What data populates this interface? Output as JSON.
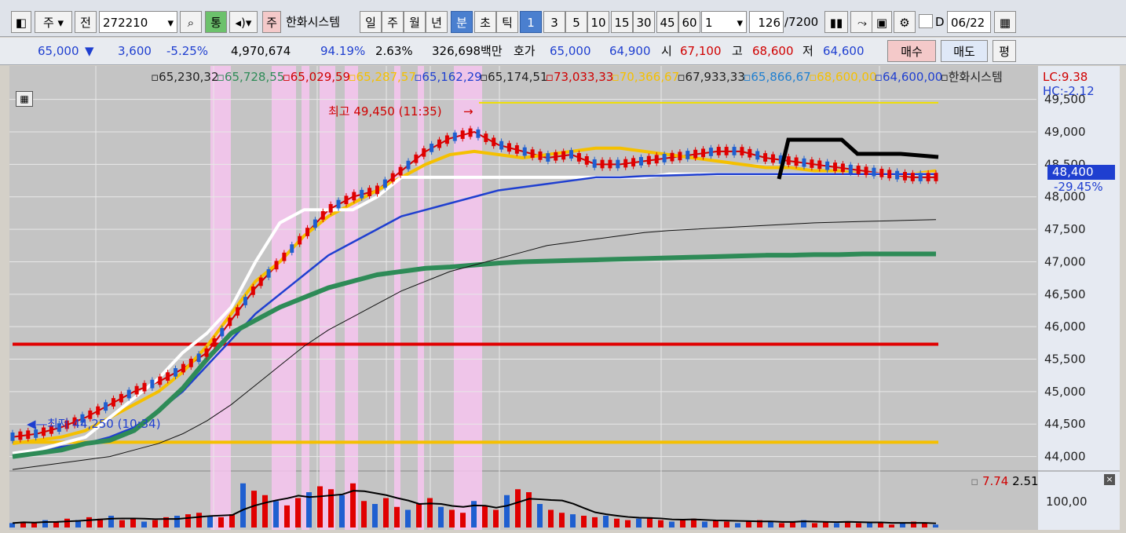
{
  "toolbar": {
    "period_dropdown": "주",
    "prev_button": "전",
    "stock_code": "272210",
    "tong_button": "통",
    "ju_badge": "주",
    "stock_name": "한화시스템",
    "period_buttons": [
      "일",
      "주",
      "월",
      "년",
      "분",
      "초",
      "틱"
    ],
    "selected_period": "분",
    "interval_buttons": [
      "1",
      "3",
      "5",
      "10",
      "15",
      "30",
      "45",
      "60"
    ],
    "selected_interval": "1",
    "multiplier_value": "1",
    "count_value": "126",
    "count_total": "/7200",
    "d_label": "D",
    "date_value": "06/22"
  },
  "quote": {
    "price": "65,000",
    "down_arrow": "▼",
    "change": "3,600",
    "change_pct": "-5.25%",
    "volume": "4,970,674",
    "vol_ratio": "94.19%",
    "turnover": "2.63%",
    "amount": "326,698백만",
    "hoga_label": "호가",
    "ask": "65,000",
    "bid": "64,900",
    "open_label": "시",
    "open": "67,100",
    "high_label": "고",
    "high": "68,600",
    "low_label": "저",
    "low": "64,600",
    "buy_button": "매수",
    "sell_button": "매도",
    "pyeong_button": "평"
  },
  "legend": {
    "items": [
      {
        "text": "65,230,32",
        "color": "#222222"
      },
      {
        "text": "65,728,55",
        "color": "#2e8b57"
      },
      {
        "text": "65,029,59",
        "color": "#d00000"
      },
      {
        "text": "65,287,57",
        "color": "#f5c000"
      },
      {
        "text": "65,162,29",
        "color": "#1f3fd0"
      },
      {
        "text": "65,174,51",
        "color": "#222222"
      },
      {
        "text": "73,033,33",
        "color": "#d00000"
      },
      {
        "text": "70,366,67",
        "color": "#f5c000"
      },
      {
        "text": "67,933,33",
        "color": "#222222"
      },
      {
        "text": "65,866,67",
        "color": "#1f7fd0"
      },
      {
        "text": "68,600,00",
        "color": "#f5c000"
      },
      {
        "text": "64,600,00",
        "color": "#1f3fd0"
      },
      {
        "text": "한화시스템",
        "color": "#222222"
      }
    ],
    "lc": "LC:9.38",
    "hc": "HC:-2.12",
    "current_price": "48,400",
    "current_pct": "-29.45%",
    "volume_legend_red": "7.74",
    "volume_legend_black": "2.51"
  },
  "chart_data": [
    {
      "type": "line",
      "title": "",
      "y_ticks": [
        44000,
        44500,
        45000,
        45500,
        46000,
        46500,
        47000,
        47500,
        48000,
        48500,
        49000,
        49500
      ],
      "y_tick_labels": [
        "44,000",
        "44,500",
        "45,000",
        "45,500",
        "46,000",
        "46,500",
        "47,000",
        "47,500",
        "48,000",
        "48,500",
        "49,000",
        "49,500"
      ],
      "ylim": [
        43850,
        49750
      ],
      "annotations": {
        "high": "최고 49,450 (11:35)",
        "low": "최저 44,250 (10:34)"
      },
      "horizontal_lines": [
        {
          "value": 49450,
          "color": "#f0e000"
        },
        {
          "value": 45730,
          "color": "#e00000"
        },
        {
          "value": 44220,
          "color": "#f5c000"
        }
      ],
      "series": [
        {
          "color": "#d00000",
          "values": [
            44300,
            44350,
            44450,
            44600,
            44800,
            45000,
            45150,
            45350,
            45600,
            46100,
            46600,
            47000,
            47400,
            47800,
            48000,
            48100,
            48400,
            48700,
            48900,
            49000,
            48800,
            48700,
            48600,
            48650,
            48500,
            48500,
            48550,
            48600,
            48650,
            48700,
            48700,
            48600,
            48550,
            48500,
            48450,
            48400,
            48350,
            48300,
            48300
          ]
        },
        {
          "color": "#f5c000",
          "values": [
            44200,
            44250,
            44300,
            44400,
            44600,
            44800,
            45000,
            45300,
            45700,
            46200,
            46700,
            47000,
            47400,
            47700,
            47900,
            48100,
            48300,
            48500,
            48650,
            48700,
            48650,
            48600,
            48650,
            48700,
            48750,
            48750,
            48700,
            48650,
            48600,
            48550,
            48500,
            48450,
            48450,
            48400,
            48400,
            48350,
            48350,
            48350,
            48400
          ]
        },
        {
          "color": "#ffffff",
          "values": [
            44050,
            44100,
            44200,
            44300,
            44600,
            44900,
            45200,
            45600,
            45900,
            46300,
            47000,
            47600,
            47800,
            47800,
            47800,
            48000,
            48300,
            48300,
            48300,
            48300,
            48300,
            48300,
            48300,
            48300,
            48300,
            48300,
            48300,
            48350,
            48350,
            48350,
            48350,
            48350,
            48350,
            48350,
            48350,
            48350,
            48350,
            48350,
            48350
          ]
        },
        {
          "color": "#1f3fd0",
          "values": [
            44000,
            44050,
            44150,
            44200,
            44300,
            44450,
            44700,
            45000,
            45400,
            45800,
            46200,
            46500,
            46800,
            47100,
            47300,
            47500,
            47700,
            47800,
            47900,
            48000,
            48100,
            48150,
            48200,
            48250,
            48300,
            48300,
            48320,
            48330,
            48340,
            48350,
            48350,
            48350,
            48350,
            48350,
            48350,
            48350,
            48350,
            48350,
            48350
          ]
        },
        {
          "color": "#2e8b57",
          "values": [
            44000,
            44050,
            44100,
            44200,
            44250,
            44400,
            44700,
            45050,
            45500,
            45900,
            46100,
            46300,
            46450,
            46600,
            46700,
            46800,
            46850,
            46900,
            46920,
            46950,
            46980,
            47000,
            47010,
            47020,
            47030,
            47040,
            47050,
            47060,
            47070,
            47080,
            47090,
            47100,
            47100,
            47110,
            47110,
            47120,
            47120,
            47120,
            47120
          ]
        },
        {
          "color": "#111111",
          "values": [
            43800,
            43850,
            43900,
            43950,
            44000,
            44100,
            44200,
            44350,
            44550,
            44800,
            45100,
            45400,
            45700,
            45950,
            46150,
            46350,
            46550,
            46700,
            46850,
            46950,
            47050,
            47150,
            47250,
            47300,
            47350,
            47400,
            47450,
            47480,
            47500,
            47520,
            47540,
            47560,
            47580,
            47600,
            47610,
            47620,
            47630,
            47640,
            47650
          ]
        }
      ]
    },
    {
      "type": "bar",
      "title": "",
      "y_ticks": [
        100
      ],
      "y_tick_labels": [
        "100,00"
      ],
      "values": [
        3,
        4,
        3,
        5,
        4,
        6,
        5,
        7,
        6,
        8,
        5,
        6,
        4,
        5,
        7,
        8,
        9,
        10,
        8,
        7,
        9,
        30,
        25,
        22,
        18,
        15,
        20,
        24,
        28,
        26,
        22,
        30,
        18,
        16,
        20,
        14,
        12,
        16,
        20,
        14,
        12,
        10,
        18,
        15,
        12,
        22,
        26,
        24,
        16,
        12,
        10,
        9,
        8,
        7,
        8,
        6,
        5,
        6,
        7,
        5,
        4,
        5,
        6,
        4,
        5,
        4,
        3,
        4,
        5,
        4,
        3,
        4,
        5,
        3,
        4,
        3,
        4,
        3,
        4,
        3,
        2,
        3,
        4,
        3,
        2
      ],
      "avg_line_note": ""
    }
  ]
}
